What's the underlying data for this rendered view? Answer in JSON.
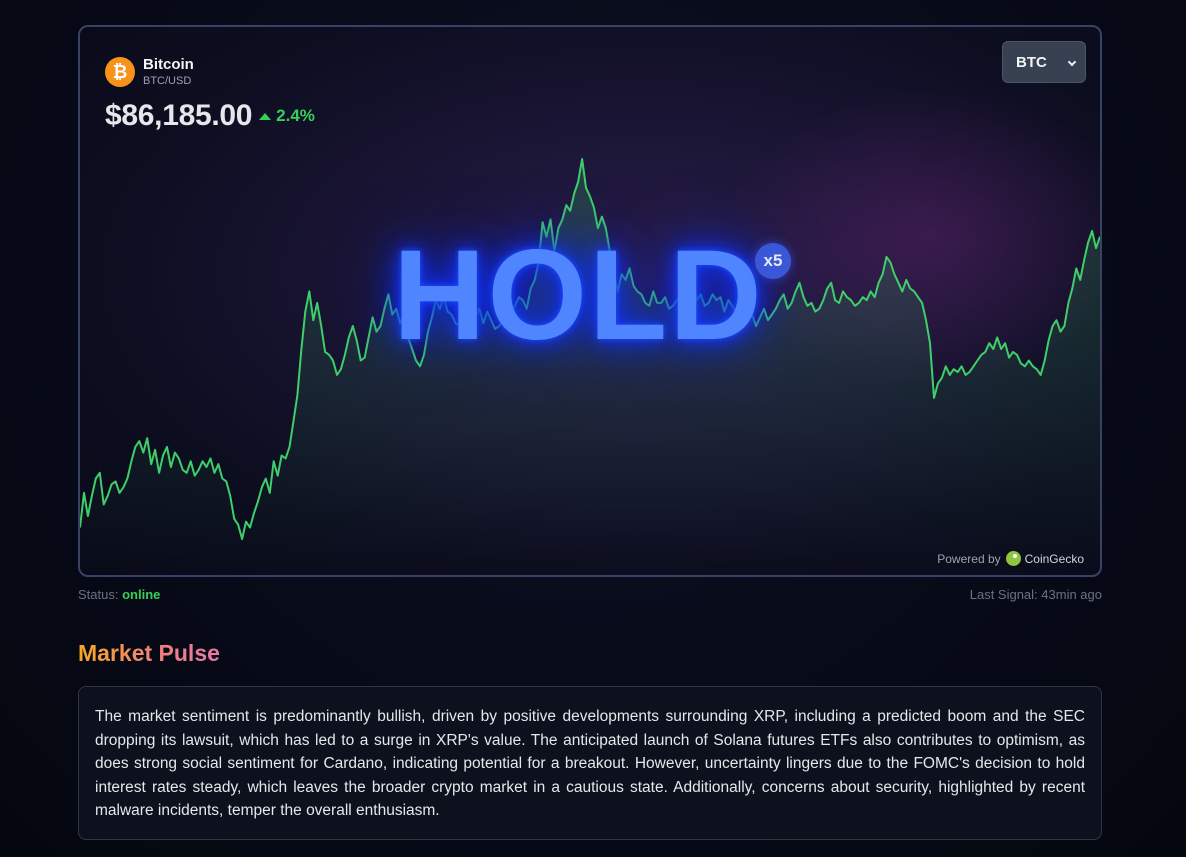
{
  "coin": {
    "name": "Bitcoin",
    "pair": "BTC/USD",
    "icon": "bitcoin-icon",
    "icon_glyph": "₿",
    "price": "$86,185.00",
    "change": "2.4%",
    "change_direction": "up"
  },
  "selector": {
    "value": "BTC"
  },
  "signal": {
    "label": "HOLD",
    "multiplier": "x5"
  },
  "attribution": {
    "prefix": "Powered by",
    "brand": "CoinGecko",
    "icon": "coingecko-icon"
  },
  "status": {
    "label": "Status:",
    "value": "online",
    "last_signal": "Last Signal: 43min ago"
  },
  "market_pulse": {
    "title": "Market Pulse",
    "text": "The market sentiment is predominantly bullish, driven by positive developments surrounding XRP, including a predicted boom and the SEC dropping its lawsuit, which has led to a surge in XRP's value. The anticipated launch of Solana futures ETFs also contributes to optimism, as does strong social sentiment for Cardano, indicating potential for a breakout. However, uncertainty lingers due to the FOMC's decision to hold interest rates steady, which leaves the broader crypto market in a cautious state. Additionally, concerns about security, highlighted by recent malware incidents, temper the overall enthusiasm."
  },
  "colors": {
    "line": "#3ecf6a",
    "positive": "#34d058",
    "signal": "#4f86ff",
    "bitcoin": "#f7931a"
  },
  "chart_data": {
    "type": "line",
    "series": [
      {
        "values": [
          79.0,
          80.2,
          79.4,
          80.1,
          80.7,
          80.9,
          79.8,
          80.1,
          80.5,
          80.6,
          80.2,
          80.4,
          80.7,
          81.3,
          81.8,
          82.0,
          81.6,
          82.1,
          81.2,
          81.7,
          80.9,
          81.5,
          81.8,
          81.1,
          81.6,
          81.4,
          81.0,
          80.9,
          81.3,
          80.8,
          81.0,
          81.3,
          81.1,
          81.4,
          80.9,
          81.2,
          80.7,
          80.6,
          80.1,
          79.3,
          79.1,
          78.6,
          79.2,
          79.0,
          79.5,
          79.9,
          80.4,
          80.7,
          80.2,
          81.3,
          80.8,
          81.5,
          81.4,
          81.8,
          82.7,
          83.6,
          85.2,
          86.5,
          87.2,
          86.2,
          86.8,
          86.0,
          85.1,
          85.0,
          84.8,
          84.3,
          84.5,
          85.0,
          85.6,
          86.0,
          85.5,
          84.8,
          84.9,
          85.6,
          86.3,
          85.8,
          86.0,
          86.6,
          87.1,
          86.4,
          86.6,
          86.1,
          86.4,
          85.6,
          85.2,
          84.8,
          84.6,
          85.0,
          85.8,
          86.3,
          86.9,
          86.6,
          87.0,
          86.5,
          86.4,
          86.1,
          86.0,
          86.3,
          86.1,
          85.9,
          86.3,
          86.6,
          86.1,
          86.5,
          86.2,
          85.9,
          86.0,
          86.2,
          86.1,
          86.5,
          86.7,
          87.0,
          86.9,
          86.6,
          87.3,
          87.6,
          88.2,
          89.6,
          89.1,
          89.7,
          88.6,
          89.4,
          89.7,
          90.2,
          90.0,
          90.6,
          91.0,
          91.8,
          90.8,
          90.5,
          90.1,
          89.4,
          89.8,
          89.4,
          88.6,
          87.9,
          87.2,
          87.8,
          87.6,
          88.0,
          87.4,
          87.2,
          87.1,
          86.8,
          86.7,
          87.2,
          86.8,
          86.8,
          87.0,
          86.6,
          86.7,
          86.9,
          87.0,
          86.5,
          86.8,
          87.5,
          86.9,
          87.1,
          86.7,
          86.8,
          87.1,
          86.9,
          87.0,
          86.5,
          86.9,
          86.7,
          86.5,
          86.2,
          86.6,
          86.2,
          86.4,
          86.0,
          86.3,
          86.6,
          86.2,
          86.4,
          86.6,
          86.9,
          87.1,
          86.6,
          86.8,
          87.2,
          87.5,
          87.0,
          86.7,
          86.8,
          86.5,
          86.6,
          86.9,
          87.3,
          87.5,
          86.9,
          86.8,
          87.2,
          87.0,
          86.9,
          86.7,
          86.8,
          87.0,
          86.9,
          87.2,
          87.0,
          87.5,
          87.8,
          88.4,
          88.2,
          87.8,
          87.5,
          87.2,
          87.6,
          87.3,
          87.2,
          87.0,
          86.8,
          86.2,
          85.4,
          83.5,
          84.0,
          84.2,
          84.6,
          84.3,
          84.5,
          84.4,
          84.6,
          84.3,
          84.4,
          84.6,
          84.8,
          85.0,
          85.1,
          85.4,
          85.2,
          85.6,
          85.2,
          85.4,
          84.9,
          85.1,
          85.0,
          84.7,
          84.6,
          84.8,
          84.6,
          84.5,
          84.3,
          84.8,
          85.5,
          86.0,
          86.2,
          85.8,
          86.0,
          86.8,
          87.3,
          88.0,
          87.6,
          88.3,
          88.9,
          89.3,
          88.7,
          89.1
        ]
      }
    ]
  }
}
